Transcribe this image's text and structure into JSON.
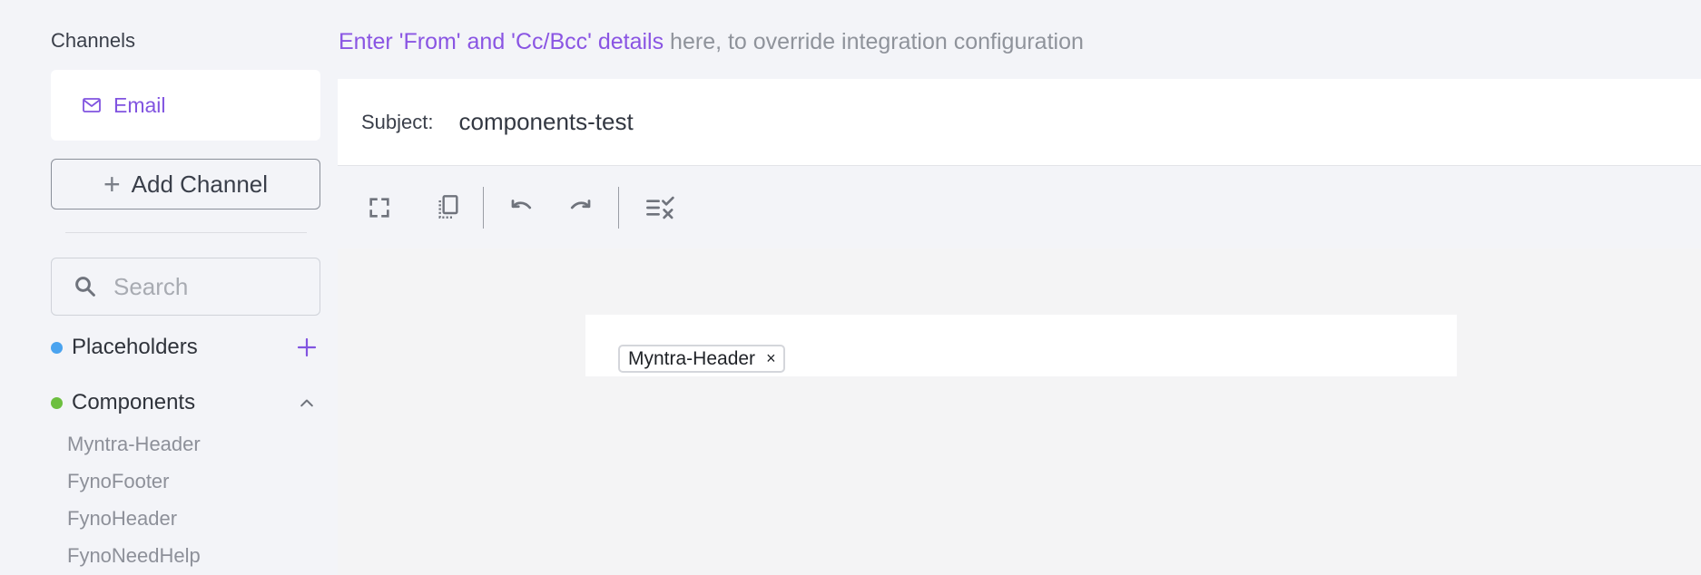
{
  "sidebar": {
    "channels_heading": "Channels",
    "channel": {
      "label": "Email",
      "icon": "mail-icon"
    },
    "add_channel_label": "Add Channel",
    "search": {
      "placeholder": "Search",
      "value": ""
    },
    "placeholders": {
      "title": "Placeholders",
      "dot_color": "#4aa3ef",
      "action_icon": "plus-icon"
    },
    "components": {
      "title": "Components",
      "dot_color": "#6cbf3f",
      "action_icon": "chevron-up-icon",
      "items": [
        "Myntra-Header",
        "FynoFooter",
        "FynoHeader",
        "FynoNeedHelp"
      ]
    }
  },
  "notice": {
    "link_text": "Enter 'From' and 'Cc/Bcc' details",
    "rest_text": " here, to override integration configuration"
  },
  "subject": {
    "label": "Subject:",
    "value": "components-test"
  },
  "toolbar": {
    "icons": [
      "fullscreen-icon",
      "copy-icon",
      "undo-icon",
      "redo-icon",
      "clear-format-icon"
    ]
  },
  "editor": {
    "chip_label": "Myntra-Header",
    "chip_close": "×"
  },
  "colors": {
    "accent": "#8154e0",
    "background": "#f3f4f8"
  }
}
